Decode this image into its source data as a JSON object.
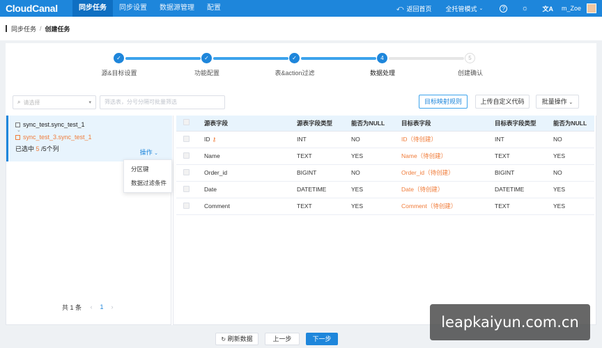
{
  "nav": {
    "logo": "CloudCanal",
    "items": [
      "同步任务",
      "同步设置",
      "数据源管理",
      "配置"
    ],
    "back_home": "返回首页",
    "mode": "全托管模式",
    "help": "?",
    "user": "m_Zoe"
  },
  "breadcrumb": {
    "parent": "同步任务",
    "current": "创建任务"
  },
  "steps": [
    {
      "num": "✓",
      "label": "源&目标设置",
      "state": "done"
    },
    {
      "num": "✓",
      "label": "功能配置",
      "state": "done"
    },
    {
      "num": "✓",
      "label": "表&action过滤",
      "state": "done"
    },
    {
      "num": "4",
      "label": "数据处理",
      "state": "current"
    },
    {
      "num": "5",
      "label": "创建确认",
      "state": "todo"
    }
  ],
  "toolbar": {
    "select_placeholder": "请选择",
    "filter_placeholder": "筛选表，分号分隔可批量筛选",
    "mapping_rule": "目标映射规则",
    "upload_code": "上传自定义代码",
    "batch_ops": "批量操作"
  },
  "left": {
    "source_table": "sync_test.sync_test_1",
    "target_table": "sync_test_3.sync_test_1",
    "chosen_prefix": "已选中",
    "chosen_count": "5",
    "chosen_suffix": "/5个列",
    "ops": "操作",
    "menu": [
      "分区键",
      "数据过滤条件"
    ],
    "total": "共 1 条",
    "page": "1"
  },
  "table": {
    "headers": [
      "源表字段",
      "源表字段类型",
      "能否为NULL",
      "目标表字段",
      "目标表字段类型",
      "能否为NULL"
    ],
    "rows": [
      {
        "src": "ID",
        "stype": "INT",
        "snull": "NO",
        "dst": "ID（待创建）",
        "dtype": "INT",
        "dnull": "NO",
        "key": true
      },
      {
        "src": "Name",
        "stype": "TEXT",
        "snull": "YES",
        "dst": "Name（待创建）",
        "dtype": "TEXT",
        "dnull": "YES"
      },
      {
        "src": "Order_id",
        "stype": "BIGINT",
        "snull": "NO",
        "dst": "Order_id（待创建）",
        "dtype": "BIGINT",
        "dnull": "NO"
      },
      {
        "src": "Date",
        "stype": "DATETIME",
        "snull": "YES",
        "dst": "Date（待创建）",
        "dtype": "DATETIME",
        "dnull": "YES"
      },
      {
        "src": "Comment",
        "stype": "TEXT",
        "snull": "YES",
        "dst": "Comment（待创建）",
        "dtype": "TEXT",
        "dnull": "YES"
      }
    ]
  },
  "footer": {
    "refresh": "刷新数据",
    "prev": "上一步",
    "next": "下一步"
  },
  "watermark": "leapkaiyun.com.cn",
  "colors": {
    "primary": "#1e86db",
    "accent": "#f07c3a"
  }
}
